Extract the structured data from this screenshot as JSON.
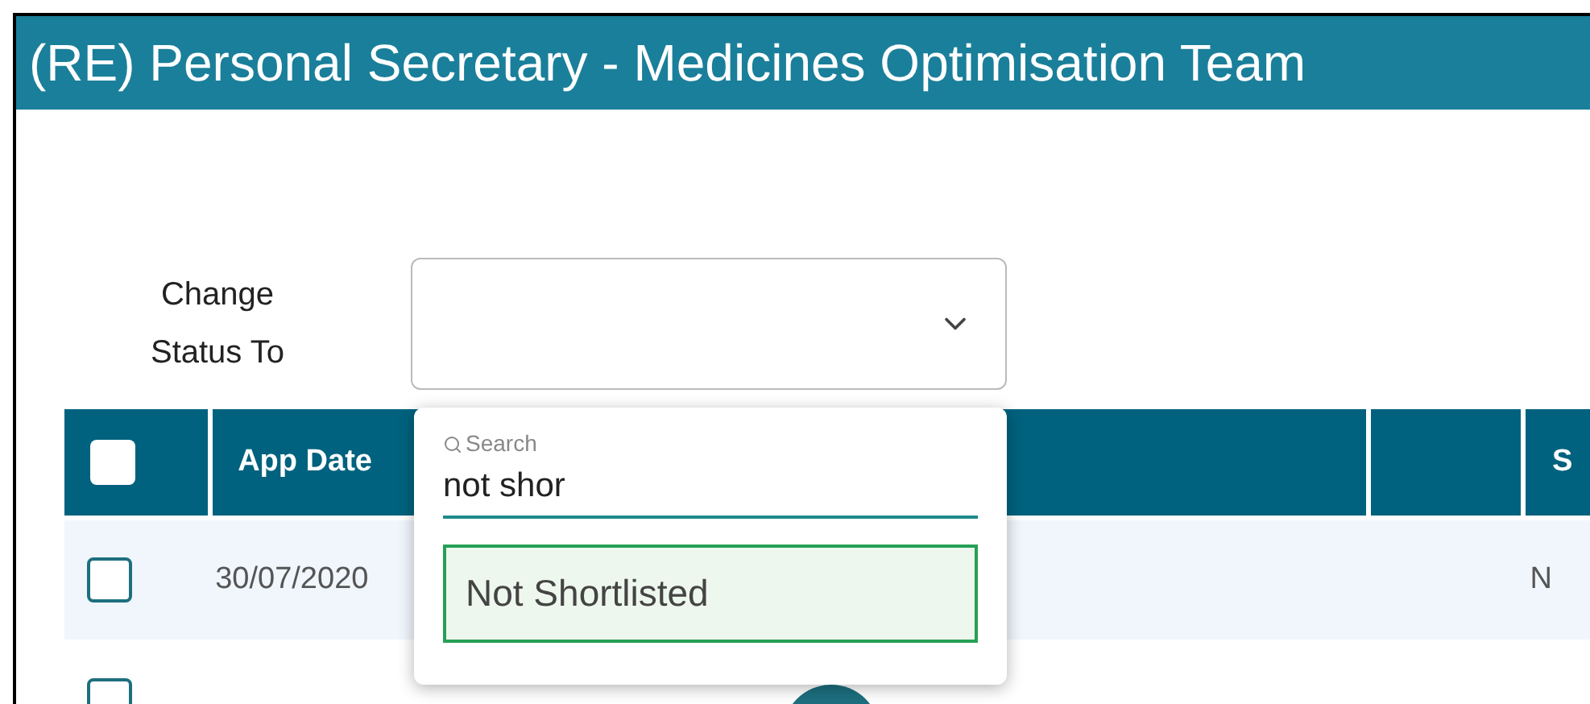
{
  "window": {
    "title": "(RE) Personal Secretary - Medicines Optimisation Team"
  },
  "status_field": {
    "label": "Change Status To",
    "expanded": true
  },
  "dropdown": {
    "search_label": "Search",
    "search_value": "not shor",
    "options": [
      {
        "label": "Not Shortlisted",
        "selected": true
      }
    ]
  },
  "table": {
    "header_checked": false,
    "columns": [
      "App Date",
      "",
      "",
      "S"
    ],
    "rows": [
      {
        "checked": false,
        "cells": [
          "30/07/2020",
          "",
          "",
          "N"
        ]
      },
      {
        "checked": false
      }
    ]
  }
}
